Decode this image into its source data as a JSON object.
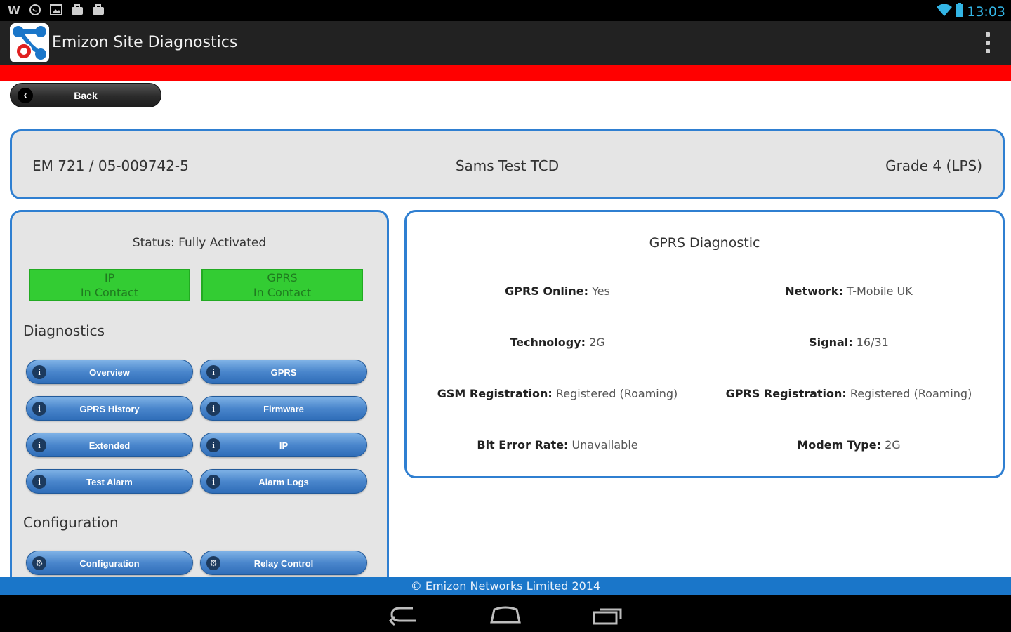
{
  "status_bar": {
    "time": "13:03",
    "left_icons": [
      "w-notification-icon",
      "whatsapp-icon",
      "image-icon",
      "briefcase-icon",
      "briefcase-icon"
    ]
  },
  "action_bar": {
    "title": "Emizon Site Diagnostics"
  },
  "back": {
    "label": "Back"
  },
  "header": {
    "device_id": "EM 721 / 05-009742-5",
    "site_name": "Sams Test TCD",
    "grade": "Grade 4 (LPS)"
  },
  "left": {
    "status": "Status: Fully Activated",
    "indicators": [
      {
        "name": "IP",
        "state": "In Contact"
      },
      {
        "name": "GPRS",
        "state": "In Contact"
      }
    ],
    "diagnostics_title": "Diagnostics",
    "diagnostics": [
      "Overview",
      "GPRS",
      "GPRS History",
      "Firmware",
      "Extended",
      "IP",
      "Test Alarm",
      "Alarm Logs"
    ],
    "configuration_title": "Configuration",
    "configuration": [
      "Configuration",
      "Relay Control"
    ]
  },
  "gprs": {
    "title": "GPRS Diagnostic",
    "fields": [
      {
        "label": "GPRS Online:",
        "value": "Yes"
      },
      {
        "label": "Network:",
        "value": "T-Mobile UK"
      },
      {
        "label": "Technology:",
        "value": "2G"
      },
      {
        "label": "Signal:",
        "value": "16/31"
      },
      {
        "label": "GSM Registration:",
        "value": "Registered (Roaming)"
      },
      {
        "label": "GPRS Registration:",
        "value": "Registered (Roaming)"
      },
      {
        "label": "Bit Error Rate:",
        "value": "Unavailable"
      },
      {
        "label": "Modem Type:",
        "value": "2G"
      }
    ]
  },
  "footer": {
    "text": "© Emizon Networks Limited 2014"
  },
  "colors": {
    "accent_red": "#ff0000",
    "panel_border": "#2f7fd1",
    "indicator_green": "#33cc33",
    "footer_blue": "#1a76c9",
    "status_time": "#33b5e5"
  }
}
